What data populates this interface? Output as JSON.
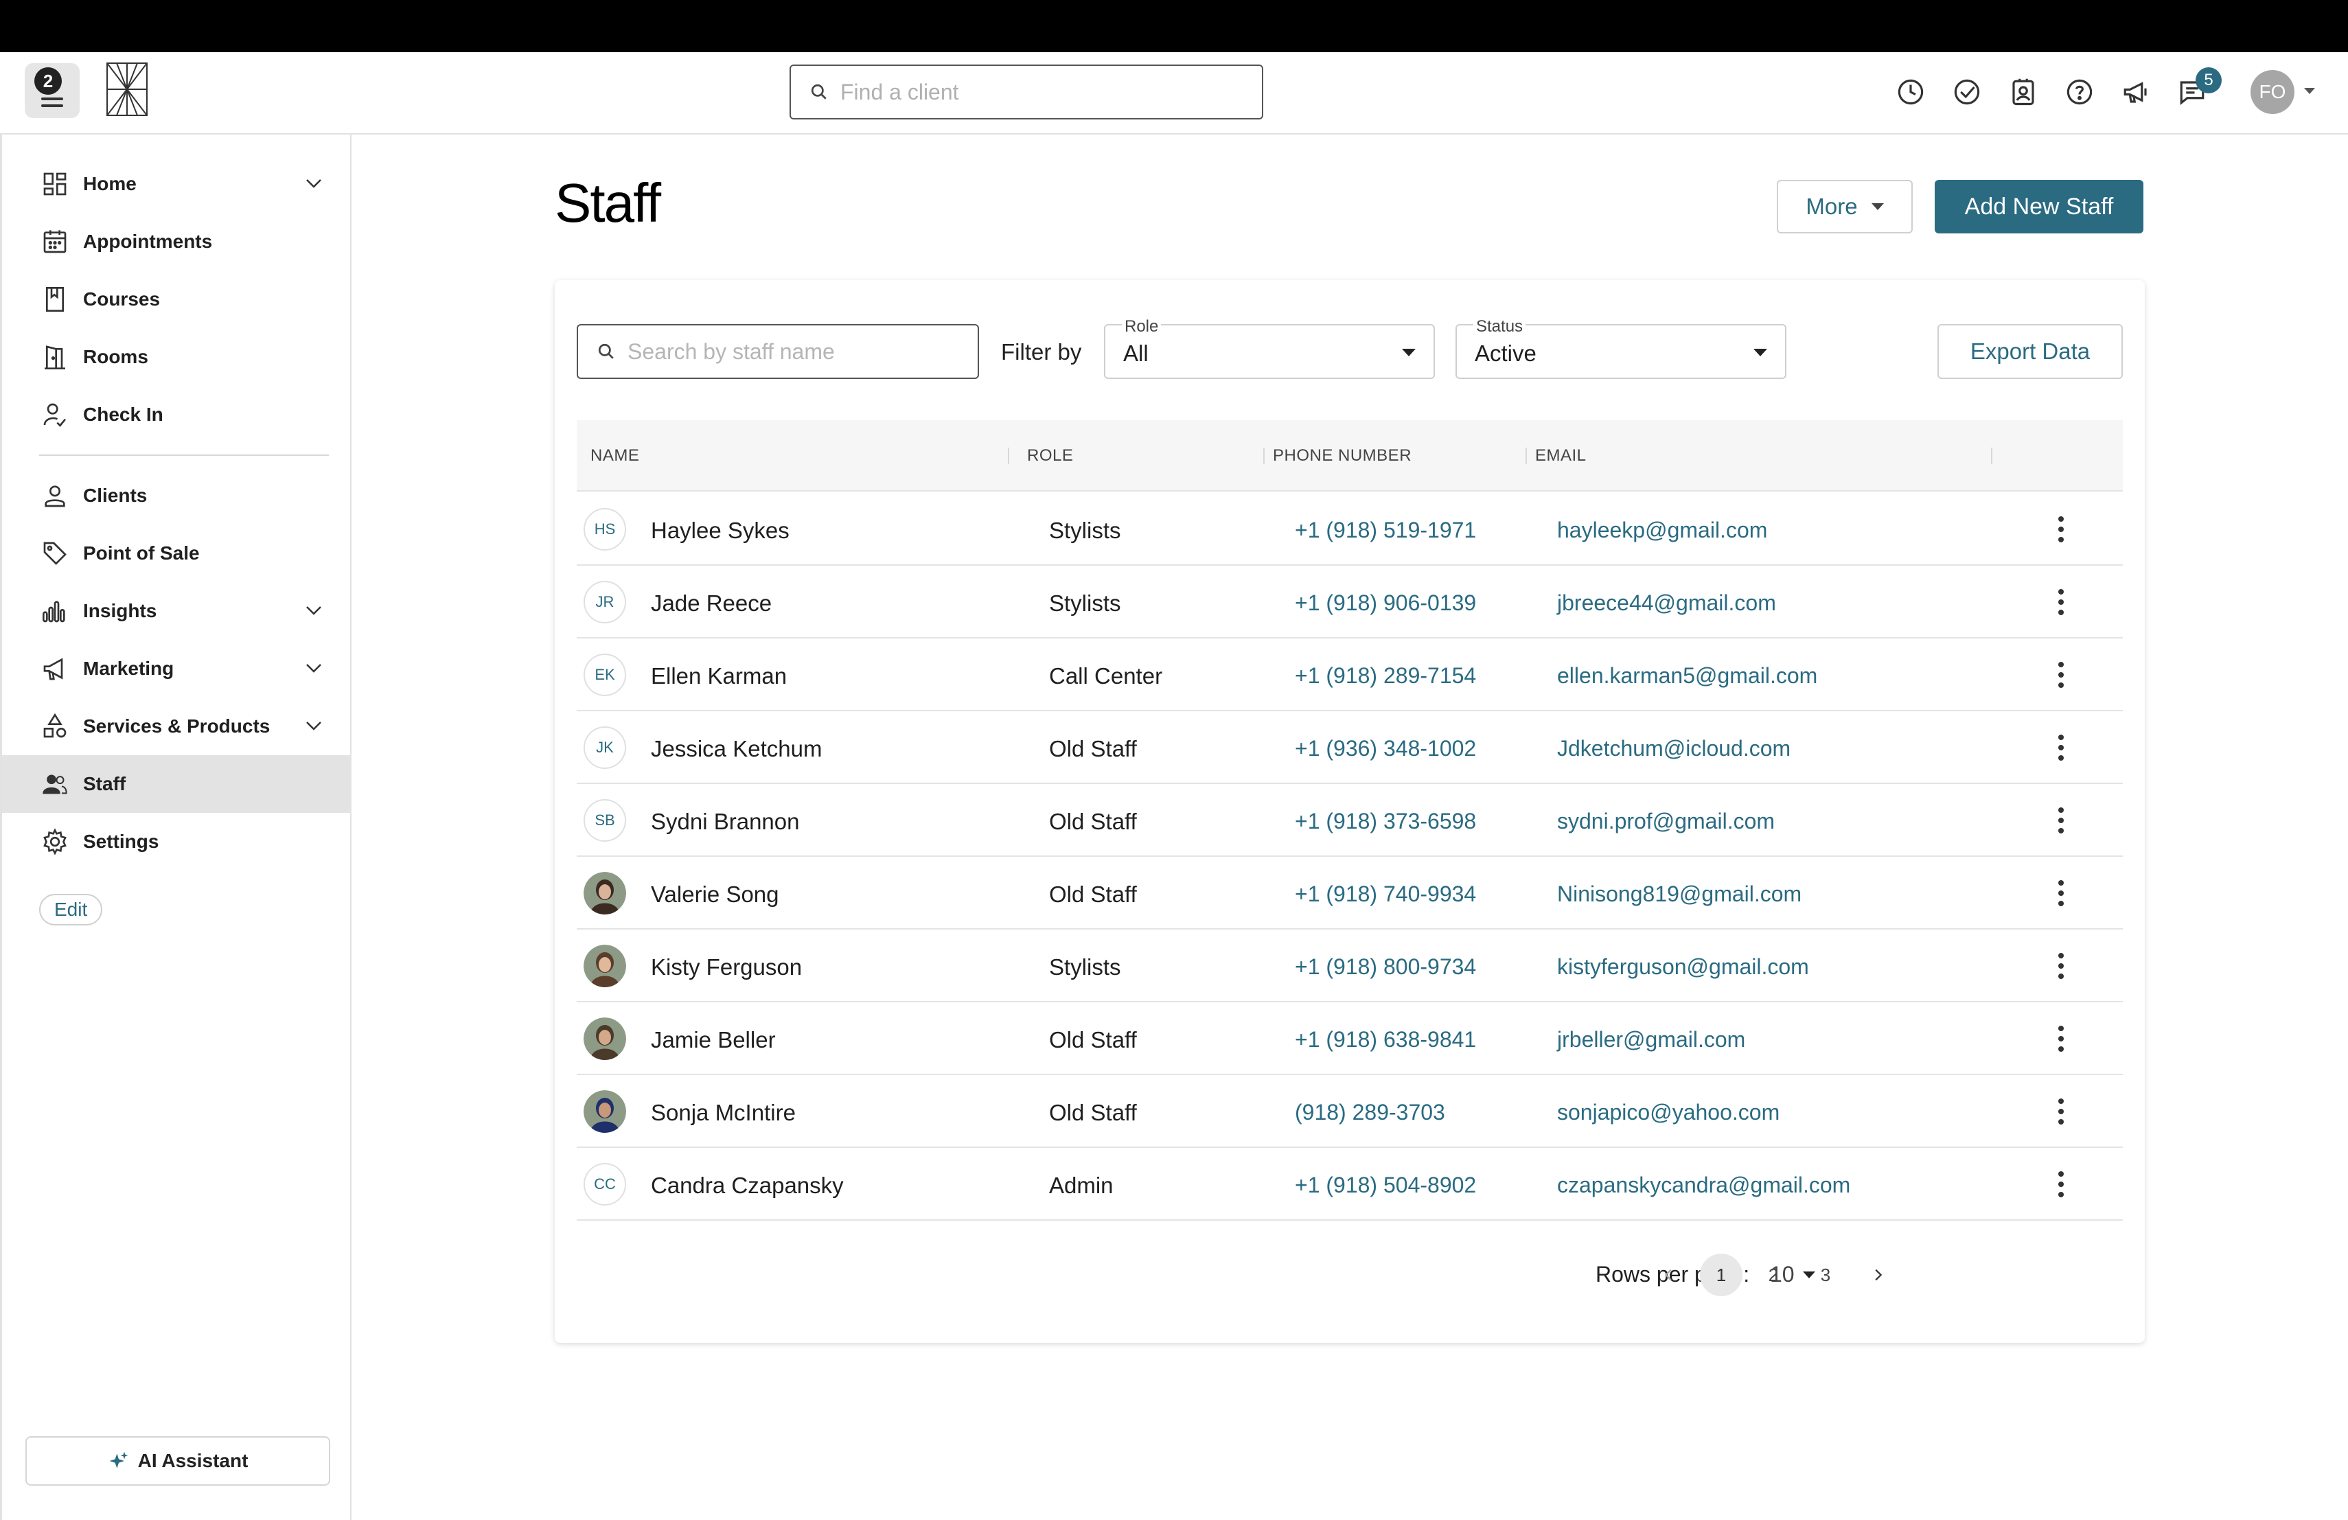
{
  "topbar": {
    "menu_badge": "2",
    "search_placeholder": "Find a client",
    "messages_count": "5",
    "user_initials": "FO"
  },
  "sidebar": {
    "items": [
      {
        "label": "Home",
        "icon": "dashboard-icon",
        "expandable": true
      },
      {
        "label": "Appointments",
        "icon": "calendar-icon",
        "expandable": false
      },
      {
        "label": "Courses",
        "icon": "book-icon",
        "expandable": false
      },
      {
        "label": "Rooms",
        "icon": "door-icon",
        "expandable": false
      },
      {
        "label": "Check In",
        "icon": "check-in-icon",
        "expandable": false
      },
      {
        "label": "Clients",
        "icon": "person-icon",
        "expandable": false
      },
      {
        "label": "Point of Sale",
        "icon": "tag-icon",
        "expandable": false
      },
      {
        "label": "Insights",
        "icon": "bar-chart-icon",
        "expandable": true
      },
      {
        "label": "Marketing",
        "icon": "megaphone-icon",
        "expandable": true
      },
      {
        "label": "Services & Products",
        "icon": "shapes-icon",
        "expandable": true
      },
      {
        "label": "Staff",
        "icon": "people-icon",
        "expandable": false,
        "active": true
      },
      {
        "label": "Settings",
        "icon": "gear-icon",
        "expandable": false
      }
    ],
    "edit_label": "Edit",
    "ai_label": "AI Assistant"
  },
  "page": {
    "title": "Staff",
    "more_label": "More",
    "add_label": "Add New Staff"
  },
  "filters": {
    "search_placeholder": "Search by staff name",
    "filter_by_label": "Filter by",
    "role_label": "Role",
    "role_value": "All",
    "status_label": "Status",
    "status_value": "Active",
    "export_label": "Export Data"
  },
  "table": {
    "columns": [
      "NAME",
      "ROLE",
      "PHONE NUMBER",
      "EMAIL"
    ],
    "rows": [
      {
        "initials": "HS",
        "photo": false,
        "name": "Haylee Sykes",
        "role": "Stylists",
        "phone": "+1 (918) 519-1971",
        "email": "hayleekp@gmail.com"
      },
      {
        "initials": "JR",
        "photo": false,
        "name": "Jade Reece",
        "role": "Stylists",
        "phone": "+1 (918) 906-0139",
        "email": "jbreece44@gmail.com"
      },
      {
        "initials": "EK",
        "photo": false,
        "name": "Ellen Karman",
        "role": "Call Center",
        "phone": "+1 (918) 289-7154",
        "email": "ellen.karman5@gmail.com"
      },
      {
        "initials": "JK",
        "photo": false,
        "name": "Jessica Ketchum",
        "role": "Old Staff",
        "phone": "+1 (936) 348-1002",
        "email": "Jdketchum@icloud.com"
      },
      {
        "initials": "SB",
        "photo": false,
        "name": "Sydni Brannon",
        "role": "Old Staff",
        "phone": "+1 (918) 373-6598",
        "email": "sydni.prof@gmail.com"
      },
      {
        "initials": "",
        "photo": true,
        "name": "Valerie Song",
        "role": "Old Staff",
        "phone": "+1 (918) 740-9934",
        "email": "Ninisong819@gmail.com"
      },
      {
        "initials": "",
        "photo": true,
        "name": "Kisty Ferguson",
        "role": "Stylists",
        "phone": "+1 (918) 800-9734",
        "email": "kistyferguson@gmail.com"
      },
      {
        "initials": "",
        "photo": true,
        "name": "Jamie Beller",
        "role": "Old Staff",
        "phone": "+1 (918) 638-9841",
        "email": "jrbeller@gmail.com"
      },
      {
        "initials": "",
        "photo": true,
        "name": "Sonja McIntire",
        "role": "Old Staff",
        "phone": "(918) 289-3703",
        "email": "sonjapico@yahoo.com"
      },
      {
        "initials": "CC",
        "photo": false,
        "name": "Candra Czapansky",
        "role": "Admin",
        "phone": "+1 (918) 504-8902",
        "email": "czapanskycandra@gmail.com"
      }
    ]
  },
  "pagination": {
    "rows_per_page_label": "Rows per page:",
    "rows_per_page_value": "10",
    "pages": [
      "1",
      "2",
      "3"
    ],
    "current_page": "1"
  },
  "colors": {
    "accent": "#2a6b82",
    "active_nav_bg": "#e3e3e3"
  }
}
